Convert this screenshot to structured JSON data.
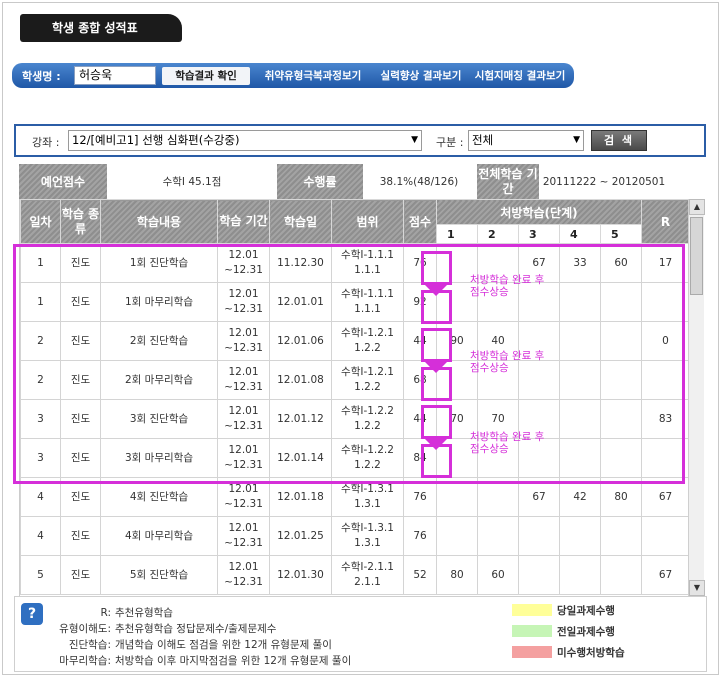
{
  "page_title": "학생 종합 성적표",
  "student": {
    "label": "학생명 :",
    "name": "허승욱"
  },
  "nav_tabs": [
    "학습결과 확인",
    "취약유형극복과정보기",
    "실력향상 결과보기",
    "시험지매칭 결과보기"
  ],
  "filter": {
    "course_label": "강좌 :",
    "course_value": "12/[예비고1] 선행 심화편(수강중)",
    "type_label": "구분 :",
    "type_value": "전체",
    "search_label": "검 색"
  },
  "summary": {
    "predicted_label": "예언점수",
    "predicted_value": "수학I 45.1점",
    "rate_label": "수행률",
    "rate_value": "38.1%(48/126)",
    "period_label": "전체학습 기간",
    "period_value": "20111222 ~ 20120501"
  },
  "table": {
    "headers": {
      "day": "일차",
      "type": "학습 종류",
      "content": "학습내용",
      "period": "학습 기간",
      "date": "학습일",
      "range": "범위",
      "score": "점수",
      "prescription": "처방학습(단계)",
      "r": "R"
    },
    "stage_headers": [
      "1",
      "2",
      "3",
      "4",
      "5"
    ],
    "rows": [
      {
        "day": "1",
        "type": "진도",
        "content": "1회 진단학습",
        "period": "12.01 ~12.31",
        "date": "11.12.30",
        "range": "수학I-1.1.1 1.1.1",
        "score": "76",
        "s1": "",
        "s2": "",
        "s3": "67",
        "s4": "33",
        "s5": "60",
        "r": "17"
      },
      {
        "day": "1",
        "type": "진도",
        "content": "1회 마무리학습",
        "period": "12.01 ~12.31",
        "date": "12.01.01",
        "range": "수학I-1.1.1 1.1.1",
        "score": "92",
        "s1": "",
        "s2": "",
        "s3": "",
        "s4": "",
        "s5": "",
        "r": ""
      },
      {
        "day": "2",
        "type": "진도",
        "content": "2회 진단학습",
        "period": "12.01 ~12.31",
        "date": "12.01.06",
        "range": "수학I-1.2.1 1.2.2",
        "score": "44",
        "s1": "90",
        "s2": "40",
        "s3": "",
        "s4": "",
        "s5": "",
        "r": "0"
      },
      {
        "day": "2",
        "type": "진도",
        "content": "2회 마무리학습",
        "period": "12.01 ~12.31",
        "date": "12.01.08",
        "range": "수학I-1.2.1 1.2.2",
        "score": "68",
        "s1": "",
        "s2": "",
        "s3": "",
        "s4": "",
        "s5": "",
        "r": ""
      },
      {
        "day": "3",
        "type": "진도",
        "content": "3회 진단학습",
        "period": "12.01 ~12.31",
        "date": "12.01.12",
        "range": "수학I-1.2.2 1.2.2",
        "score": "44",
        "s1": "70",
        "s2": "70",
        "s3": "",
        "s4": "",
        "s5": "",
        "r": "83"
      },
      {
        "day": "3",
        "type": "진도",
        "content": "3회 마무리학습",
        "period": "12.01 ~12.31",
        "date": "12.01.14",
        "range": "수학I-1.2.2 1.2.2",
        "score": "84",
        "s1": "",
        "s2": "",
        "s3": "",
        "s4": "",
        "s5": "",
        "r": ""
      },
      {
        "day": "4",
        "type": "진도",
        "content": "4회 진단학습",
        "period": "12.01 ~12.31",
        "date": "12.01.18",
        "range": "수학I-1.3.1 1.3.1",
        "score": "76",
        "s1": "",
        "s2": "",
        "s3": "67",
        "s4": "42",
        "s5": "80",
        "r": "67"
      },
      {
        "day": "4",
        "type": "진도",
        "content": "4회 마무리학습",
        "period": "12.01 ~12.31",
        "date": "12.01.25",
        "range": "수학I-1.3.1 1.3.1",
        "score": "76",
        "s1": "",
        "s2": "",
        "s3": "",
        "s4": "",
        "s5": "",
        "r": ""
      },
      {
        "day": "5",
        "type": "진도",
        "content": "5회 진단학습",
        "period": "12.01 ~12.31",
        "date": "12.01.30",
        "range": "수학I-2.1.1 2.1.1",
        "score": "52",
        "s1": "80",
        "s2": "60",
        "s3": "",
        "s4": "",
        "s5": "",
        "r": "67"
      }
    ]
  },
  "annotations": [
    "처방학습 완료 후\n점수상승",
    "처방학습 완료 후\n점수상승",
    "처방학습 완료 후\n점수상승"
  ],
  "legend": {
    "lines": [
      {
        "key": "R:",
        "text": "추천유형학습"
      },
      {
        "key": "유형이해도:",
        "text": "추천유형학습 정답문제수/출제문제수"
      },
      {
        "key": "진단학습:",
        "text": "개념학습 이해도 점검을 위한 12개 유형문제 풀이"
      },
      {
        "key": "마무리학습:",
        "text": "처방학습 이후 마지막점검을 위한 12개 유형문제 풀이"
      }
    ],
    "swatches": [
      {
        "label": "당일과제수행",
        "color": "#ffff99"
      },
      {
        "label": "전일과제수행",
        "color": "#c6f5b6"
      },
      {
        "label": "미수행처방학습",
        "color": "#f4a0a0"
      }
    ]
  },
  "colors": {
    "accent": "#d52fd9",
    "nav": "#1f57a7"
  }
}
